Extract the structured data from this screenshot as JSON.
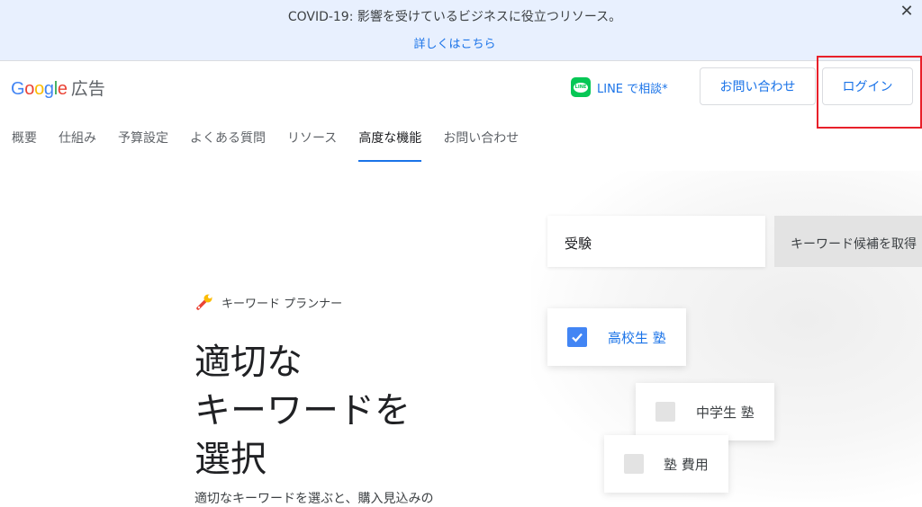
{
  "banner": {
    "message": "COVID-19: 影響を受けているビジネスに役立つリソース。",
    "link": "詳しくはこちら",
    "close": "✕"
  },
  "header": {
    "logo_google": [
      "G",
      "o",
      "o",
      "g",
      "l",
      "e"
    ],
    "logo_product": "広告",
    "line_icon_text": "LINE",
    "line_label": "LINE で相談*",
    "contact_button": "お問い合わせ",
    "login_button": "ログイン"
  },
  "nav": {
    "items": [
      {
        "label": "概要"
      },
      {
        "label": "仕組み"
      },
      {
        "label": "予算設定"
      },
      {
        "label": "よくある質問"
      },
      {
        "label": "リソース"
      },
      {
        "label": "高度な機能"
      },
      {
        "label": "お問い合わせ"
      }
    ],
    "active": "高度な機能"
  },
  "hero": {
    "eyebrow": "キーワード プランナー",
    "title_lines": [
      "適切な",
      "キーワードを",
      "選択"
    ],
    "description": "適切なキーワードを選ぶと、購入見込みの"
  },
  "illustration": {
    "search_value": "受験",
    "get_button": "キーワード候補を取得",
    "keywords": [
      {
        "text": "高校生 塾",
        "checked": true
      },
      {
        "text": "中学生 塾",
        "checked": false
      },
      {
        "text": "塾 費用",
        "checked": false
      }
    ]
  },
  "colors": {
    "accent": "#1a73e8",
    "highlight": "#e8202a",
    "banner_bg": "#e8f0fe",
    "line_green": "#06c755"
  }
}
